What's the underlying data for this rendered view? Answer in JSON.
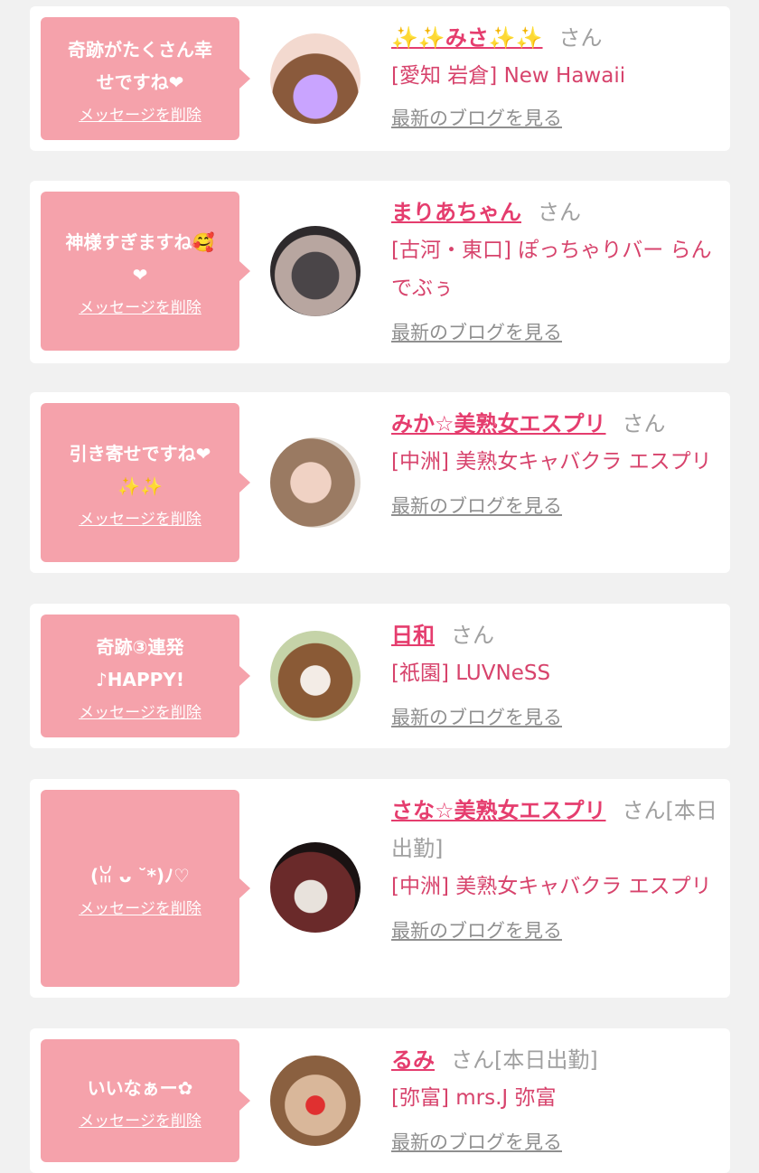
{
  "delete_label": "メッセージを削除",
  "blog_label": "最新のブログを見る",
  "san_label": "さん",
  "cards": [
    {
      "message": "奇跡がたくさん幸\nせですね❤",
      "name": "✨✨みさ✨✨",
      "extra": "",
      "shop": "[愛知 岩倉] New Hawaii"
    },
    {
      "message": "神様すぎますね🥰\n❤",
      "name": "まりあちゃん",
      "extra": "",
      "shop": "[古河・東口] ぽっちゃりバー らんでぶぅ"
    },
    {
      "message": "引き寄せですね❤\n✨✨",
      "name": "みか☆美熟女エスプリ",
      "extra": "",
      "shop": "[中洲] 美熟女キャバクラ エスプリ"
    },
    {
      "message": "奇跡③連発\n♪HAPPY!",
      "name": "日和",
      "extra": "",
      "shop": "[祇園] LUVNeSS"
    },
    {
      "message": "(ꈍ ᴗ ˘*)ﾉ♡",
      "name": "さな☆美熟女エスプリ",
      "extra": "[本日出勤]",
      "shop": "[中洲] 美熟女キャバクラ エスプリ"
    },
    {
      "message": "いいなぁー✿",
      "name": "るみ",
      "extra": "[本日出勤]",
      "shop": "[弥富] mrs.J 弥富"
    }
  ]
}
